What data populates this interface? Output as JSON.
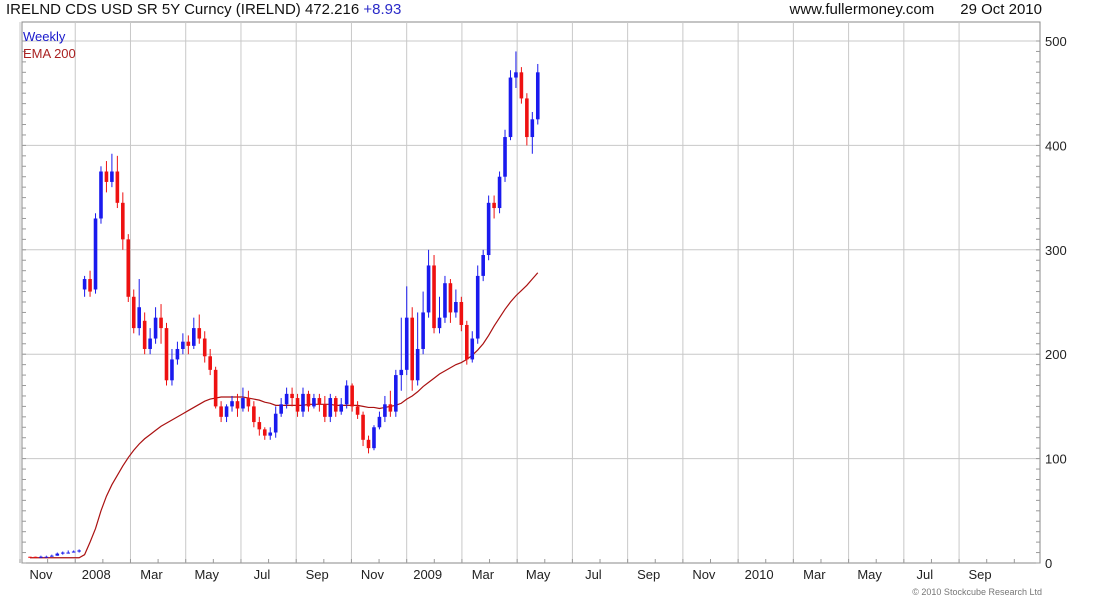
{
  "header": {
    "title": "IRELND CDS USD SR 5Y Curncy (IRELND)",
    "last": "472.216",
    "change": "+8.93",
    "site": "www.fullermoney.com",
    "date": "29 Oct 2010"
  },
  "copyright": "© 2010 Stockcube Research Ltd",
  "colors": {
    "up": "#1a1aee",
    "down": "#ee1111",
    "ema": "#aa1111",
    "grid": "#c8c8c8",
    "legend_weekly": "#1a1acc",
    "legend_ema": "#aa2222"
  },
  "chart_data": {
    "type": "candlestick",
    "interval": "Weekly",
    "legend": [
      {
        "name": "Weekly",
        "color": "#1a1acc"
      },
      {
        "name": "EMA 200",
        "color": "#aa2222"
      }
    ],
    "yaxis": {
      "side": "right",
      "ylim": [
        0,
        500
      ],
      "ticks": [
        0,
        100,
        200,
        300,
        400,
        500
      ]
    },
    "xaxis": {
      "ticks": [
        "Nov",
        "2008",
        "Mar",
        "May",
        "Jul",
        "Sep",
        "Nov",
        "2009",
        "Mar",
        "May",
        "Jul",
        "Sep",
        "Nov",
        "2010",
        "Mar",
        "May",
        "Jul",
        "Sep"
      ]
    },
    "candles": [
      [
        6,
        5,
        6,
        5
      ],
      [
        6,
        5,
        6,
        5
      ],
      [
        6,
        6,
        7,
        5
      ],
      [
        6,
        6,
        7,
        6
      ],
      [
        7,
        7,
        8,
        6
      ],
      [
        7,
        9,
        10,
        7
      ],
      [
        9,
        10,
        11,
        8
      ],
      [
        10,
        10,
        12,
        9
      ],
      [
        10,
        11,
        12,
        10
      ],
      [
        11,
        12,
        13,
        10
      ],
      [
        262,
        272,
        275,
        255
      ],
      [
        272,
        260,
        280,
        255
      ],
      [
        262,
        330,
        335,
        258
      ],
      [
        330,
        375,
        380,
        325
      ],
      [
        375,
        365,
        385,
        355
      ],
      [
        365,
        375,
        392,
        360
      ],
      [
        375,
        345,
        390,
        340
      ],
      [
        345,
        310,
        355,
        300
      ],
      [
        310,
        255,
        315,
        250
      ],
      [
        255,
        225,
        262,
        220
      ],
      [
        225,
        245,
        272,
        218
      ],
      [
        232,
        205,
        240,
        200
      ],
      [
        205,
        215,
        225,
        200
      ],
      [
        215,
        235,
        245,
        210
      ],
      [
        235,
        225,
        248,
        210
      ],
      [
        225,
        175,
        230,
        170
      ],
      [
        175,
        195,
        205,
        170
      ],
      [
        195,
        205,
        212,
        190
      ],
      [
        205,
        212,
        220,
        200
      ],
      [
        212,
        208,
        218,
        200
      ],
      [
        208,
        225,
        235,
        205
      ],
      [
        225,
        215,
        238,
        210
      ],
      [
        215,
        198,
        222,
        192
      ],
      [
        198,
        185,
        205,
        180
      ],
      [
        185,
        150,
        188,
        148
      ],
      [
        150,
        140,
        155,
        135
      ],
      [
        140,
        150,
        152,
        135
      ],
      [
        150,
        155,
        160,
        145
      ],
      [
        155,
        148,
        162,
        140
      ],
      [
        148,
        158,
        168,
        145
      ],
      [
        158,
        150,
        165,
        145
      ],
      [
        150,
        135,
        155,
        130
      ],
      [
        135,
        128,
        140,
        122
      ],
      [
        128,
        122,
        130,
        118
      ],
      [
        122,
        125,
        130,
        118
      ],
      [
        125,
        143,
        150,
        120
      ],
      [
        143,
        152,
        158,
        140
      ],
      [
        152,
        162,
        168,
        148
      ],
      [
        162,
        158,
        168,
        150
      ],
      [
        158,
        145,
        162,
        140
      ],
      [
        145,
        162,
        168,
        140
      ],
      [
        162,
        150,
        165,
        145
      ],
      [
        150,
        158,
        162,
        148
      ],
      [
        158,
        152,
        162,
        145
      ],
      [
        152,
        140,
        160,
        135
      ],
      [
        140,
        158,
        162,
        135
      ],
      [
        158,
        145,
        160,
        140
      ],
      [
        145,
        152,
        158,
        142
      ],
      [
        152,
        170,
        175,
        148
      ],
      [
        170,
        150,
        172,
        145
      ],
      [
        150,
        142,
        155,
        138
      ],
      [
        142,
        118,
        145,
        112
      ],
      [
        118,
        110,
        122,
        105
      ],
      [
        110,
        130,
        132,
        108
      ],
      [
        130,
        140,
        145,
        128
      ],
      [
        140,
        152,
        160,
        135
      ],
      [
        152,
        145,
        165,
        140
      ],
      [
        145,
        180,
        185,
        140
      ],
      [
        180,
        185,
        235,
        165
      ],
      [
        185,
        235,
        265,
        180
      ],
      [
        235,
        175,
        245,
        165
      ],
      [
        175,
        205,
        240,
        170
      ],
      [
        205,
        240,
        260,
        200
      ],
      [
        240,
        285,
        300,
        235
      ],
      [
        285,
        225,
        295,
        220
      ],
      [
        225,
        235,
        255,
        220
      ],
      [
        235,
        268,
        275,
        230
      ],
      [
        268,
        240,
        272,
        230
      ],
      [
        240,
        250,
        262,
        235
      ],
      [
        250,
        228,
        255,
        222
      ],
      [
        228,
        195,
        232,
        190
      ],
      [
        195,
        215,
        222,
        192
      ],
      [
        215,
        275,
        285,
        210
      ],
      [
        275,
        295,
        300,
        270
      ],
      [
        295,
        345,
        352,
        290
      ],
      [
        345,
        340,
        352,
        330
      ],
      [
        340,
        370,
        375,
        335
      ],
      [
        370,
        408,
        415,
        365
      ],
      [
        408,
        465,
        472,
        405
      ],
      [
        465,
        470,
        490,
        455
      ],
      [
        470,
        445,
        475,
        440
      ],
      [
        445,
        408,
        450,
        400
      ],
      [
        408,
        425,
        432,
        392
      ],
      [
        425,
        470,
        478,
        420
      ]
    ],
    "ema200": [
      [
        0,
        5
      ],
      [
        9,
        5
      ],
      [
        10,
        8
      ],
      [
        11,
        20
      ],
      [
        12,
        33
      ],
      [
        13,
        50
      ],
      [
        14,
        64
      ],
      [
        15,
        75
      ],
      [
        16,
        84
      ],
      [
        17,
        93
      ],
      [
        18,
        101
      ],
      [
        19,
        108
      ],
      [
        20,
        114
      ],
      [
        21,
        119
      ],
      [
        22,
        123
      ],
      [
        23,
        127
      ],
      [
        24,
        131
      ],
      [
        25,
        134
      ],
      [
        26,
        137
      ],
      [
        27,
        140
      ],
      [
        28,
        143
      ],
      [
        29,
        146
      ],
      [
        30,
        149
      ],
      [
        31,
        152
      ],
      [
        32,
        155
      ],
      [
        33,
        157
      ],
      [
        34,
        158
      ],
      [
        35,
        159
      ],
      [
        36,
        159
      ],
      [
        37,
        159
      ],
      [
        38,
        159
      ],
      [
        39,
        159
      ],
      [
        40,
        158
      ],
      [
        41,
        157
      ],
      [
        42,
        156
      ],
      [
        43,
        154
      ],
      [
        44,
        153
      ],
      [
        45,
        151
      ],
      [
        46,
        151
      ],
      [
        47,
        151
      ],
      [
        48,
        151
      ],
      [
        49,
        151
      ],
      [
        50,
        151
      ],
      [
        51,
        152
      ],
      [
        52,
        152
      ],
      [
        53,
        152
      ],
      [
        54,
        152
      ],
      [
        55,
        152
      ],
      [
        56,
        151
      ],
      [
        57,
        151
      ],
      [
        58,
        151
      ],
      [
        59,
        151
      ],
      [
        60,
        151
      ],
      [
        61,
        150
      ],
      [
        62,
        149
      ],
      [
        63,
        149
      ],
      [
        64,
        148
      ],
      [
        65,
        149
      ],
      [
        66,
        150
      ],
      [
        67,
        151
      ],
      [
        68,
        153
      ],
      [
        69,
        157
      ],
      [
        70,
        160
      ],
      [
        71,
        164
      ],
      [
        72,
        169
      ],
      [
        73,
        173
      ],
      [
        74,
        177
      ],
      [
        75,
        181
      ],
      [
        76,
        184
      ],
      [
        77,
        187
      ],
      [
        78,
        190
      ],
      [
        79,
        192
      ],
      [
        80,
        195
      ],
      [
        81,
        199
      ],
      [
        82,
        204
      ],
      [
        83,
        210
      ],
      [
        84,
        218
      ],
      [
        85,
        227
      ],
      [
        86,
        235
      ],
      [
        87,
        243
      ],
      [
        88,
        250
      ],
      [
        89,
        256
      ],
      [
        90,
        261
      ],
      [
        91,
        266
      ],
      [
        92,
        272
      ],
      [
        93,
        278
      ]
    ]
  }
}
